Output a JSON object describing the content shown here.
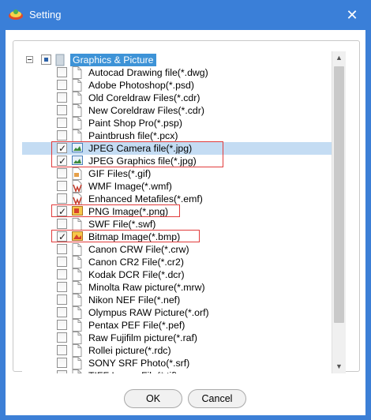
{
  "window": {
    "title": "Setting",
    "close_glyph": "✕"
  },
  "tree": {
    "root_label": "Graphics & Picture",
    "items": [
      {
        "label": "Autocad Drawing file(*.dwg)",
        "checked": false
      },
      {
        "label": "Adobe Photoshop(*.psd)",
        "checked": false
      },
      {
        "label": "Old Coreldraw Files(*.cdr)",
        "checked": false
      },
      {
        "label": "New Coreldraw Files(*.cdr)",
        "checked": false
      },
      {
        "label": "Paint Shop Pro(*.psp)",
        "checked": false
      },
      {
        "label": "Paintbrush file(*.pcx)",
        "checked": false
      },
      {
        "label": "JPEG Camera file(*.jpg)",
        "checked": true
      },
      {
        "label": "JPEG Graphics file(*.jpg)",
        "checked": true
      },
      {
        "label": "GIF Files(*.gif)",
        "checked": false
      },
      {
        "label": "WMF Image(*.wmf)",
        "checked": false
      },
      {
        "label": "Enhanced Metafiles(*.emf)",
        "checked": false
      },
      {
        "label": "PNG Image(*.png)",
        "checked": true
      },
      {
        "label": "SWF File(*.swf)",
        "checked": false
      },
      {
        "label": "Bitmap Image(*.bmp)",
        "checked": true
      },
      {
        "label": "Canon CRW File(*.crw)",
        "checked": false
      },
      {
        "label": "Canon CR2 File(*.cr2)",
        "checked": false
      },
      {
        "label": "Kodak DCR File(*.dcr)",
        "checked": false
      },
      {
        "label": "Minolta Raw picture(*.mrw)",
        "checked": false
      },
      {
        "label": "Nikon NEF File(*.nef)",
        "checked": false
      },
      {
        "label": "Olympus RAW Picture(*.orf)",
        "checked": false
      },
      {
        "label": "Pentax PEF File(*.pef)",
        "checked": false
      },
      {
        "label": "Raw Fujifilm picture(*.raf)",
        "checked": false
      },
      {
        "label": "Rollei picture(*.rdc)",
        "checked": false
      },
      {
        "label": "SONY SRF Photo(*.srf)",
        "checked": false
      },
      {
        "label": "TIFF Image File(*.tif)",
        "checked": false
      }
    ]
  },
  "buttons": {
    "ok": "OK",
    "cancel": "Cancel"
  },
  "colors": {
    "titlebar": "#3a7fd8",
    "selection": "#3d93d7",
    "highlight_box": "#e13c3c"
  }
}
